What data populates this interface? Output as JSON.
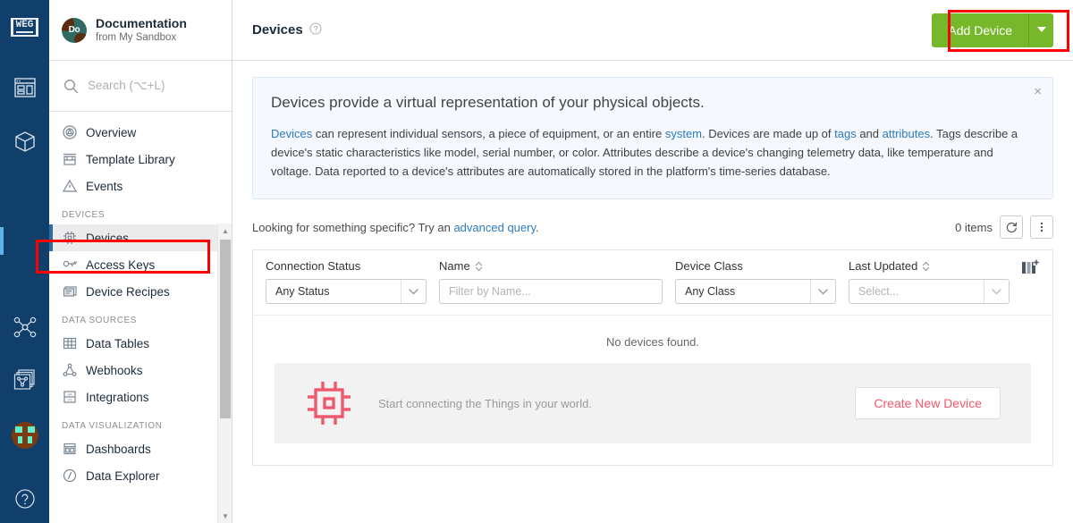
{
  "rail": {
    "logo_text": "WEG",
    "icons": [
      {
        "name": "weg-logo",
        "label": "WEG"
      },
      {
        "name": "dashboard-icon",
        "label": "Dashboard"
      },
      {
        "name": "package-icon",
        "label": "Applications"
      },
      {
        "name": "nodes-icon",
        "label": "Workflows"
      },
      {
        "name": "layers-nodes-icon",
        "label": "Flows"
      },
      {
        "name": "avatar-icon",
        "label": "Account"
      },
      {
        "name": "help-icon",
        "label": "Help"
      }
    ]
  },
  "workspace": {
    "avatar_initials": "Do",
    "name": "Documentation",
    "subtitle": "from My Sandbox"
  },
  "search": {
    "placeholder": "Search (⌥+L)",
    "icon": "search-icon"
  },
  "sidebar": {
    "groups": [
      {
        "section": "",
        "items": [
          {
            "label": "Overview",
            "icon": "target-icon",
            "active": false
          },
          {
            "label": "Template Library",
            "icon": "library-icon",
            "active": false
          },
          {
            "label": "Events",
            "icon": "warning-triangle-icon",
            "active": false
          }
        ]
      },
      {
        "section": "DEVICES",
        "items": [
          {
            "label": "Devices",
            "icon": "chip-icon",
            "active": true
          },
          {
            "label": "Access Keys",
            "icon": "key-icon",
            "active": false
          },
          {
            "label": "Device Recipes",
            "icon": "recipe-icon",
            "active": false
          }
        ]
      },
      {
        "section": "DATA SOURCES",
        "items": [
          {
            "label": "Data Tables",
            "icon": "table-icon",
            "active": false
          },
          {
            "label": "Webhooks",
            "icon": "webhook-icon",
            "active": false
          },
          {
            "label": "Integrations",
            "icon": "integrations-icon",
            "active": false
          }
        ]
      },
      {
        "section": "DATA VISUALIZATION",
        "items": [
          {
            "label": "Dashboards",
            "icon": "dashboard-grid-icon",
            "active": false
          },
          {
            "label": "Data Explorer",
            "icon": "compass-icon",
            "active": false
          }
        ]
      }
    ]
  },
  "topbar": {
    "title": "Devices",
    "help_icon": "question-circle-icon",
    "add_button_label": "Add Device",
    "add_button_caret": "▾",
    "add_button_color": "#76b82a"
  },
  "banner": {
    "title": "Devices provide a virtual representation of your physical objects.",
    "close_label": "×",
    "link_devices": "Devices",
    "text_1": " can represent individual sensors, a piece of equipment, or an entire ",
    "link_system": "system",
    "text_2": ". Devices are made up of ",
    "link_tags": "tags",
    "text_3": " and ",
    "link_attributes": "attributes",
    "text_4": ". Tags describe a device's static characteristics like model, serial number, or color. Attributes describe a device's changing telemetry data, like temperature and voltage. Data reported to a device's attributes are automatically stored in the platform's time-series database.",
    "link_color": "#2b7bbd"
  },
  "query": {
    "prompt": "Looking for something specific? Try an ",
    "link": "advanced query",
    "period": ".",
    "items_count": "0 items",
    "refresh_icon": "refresh-icon",
    "more_icon": "kebab-menu-icon"
  },
  "table": {
    "columns": [
      {
        "label": "Connection Status",
        "sortable": false,
        "filter_value": "Any Status",
        "filter_placeholder": "",
        "type": "select"
      },
      {
        "label": "Name",
        "sortable": true,
        "filter_value": "",
        "filter_placeholder": "Filter by Name...",
        "type": "text"
      },
      {
        "label": "Device Class",
        "sortable": false,
        "filter_value": "Any Class",
        "filter_placeholder": "",
        "type": "select"
      },
      {
        "label": "Last Updated",
        "sortable": true,
        "filter_value": "",
        "filter_placeholder": "Select...",
        "type": "select"
      }
    ],
    "column_config_icon": "add-column-icon",
    "empty_message": "No devices found.",
    "empty_cta_text": "Start connecting the Things in your world.",
    "empty_cta_button": "Create New Device",
    "empty_icon": "chip-outline-icon",
    "accent_red": "#f0576b"
  },
  "annotations": {
    "color": "#ff0000",
    "boxes": [
      "add-device-button",
      "sidebar-item-devices"
    ]
  }
}
